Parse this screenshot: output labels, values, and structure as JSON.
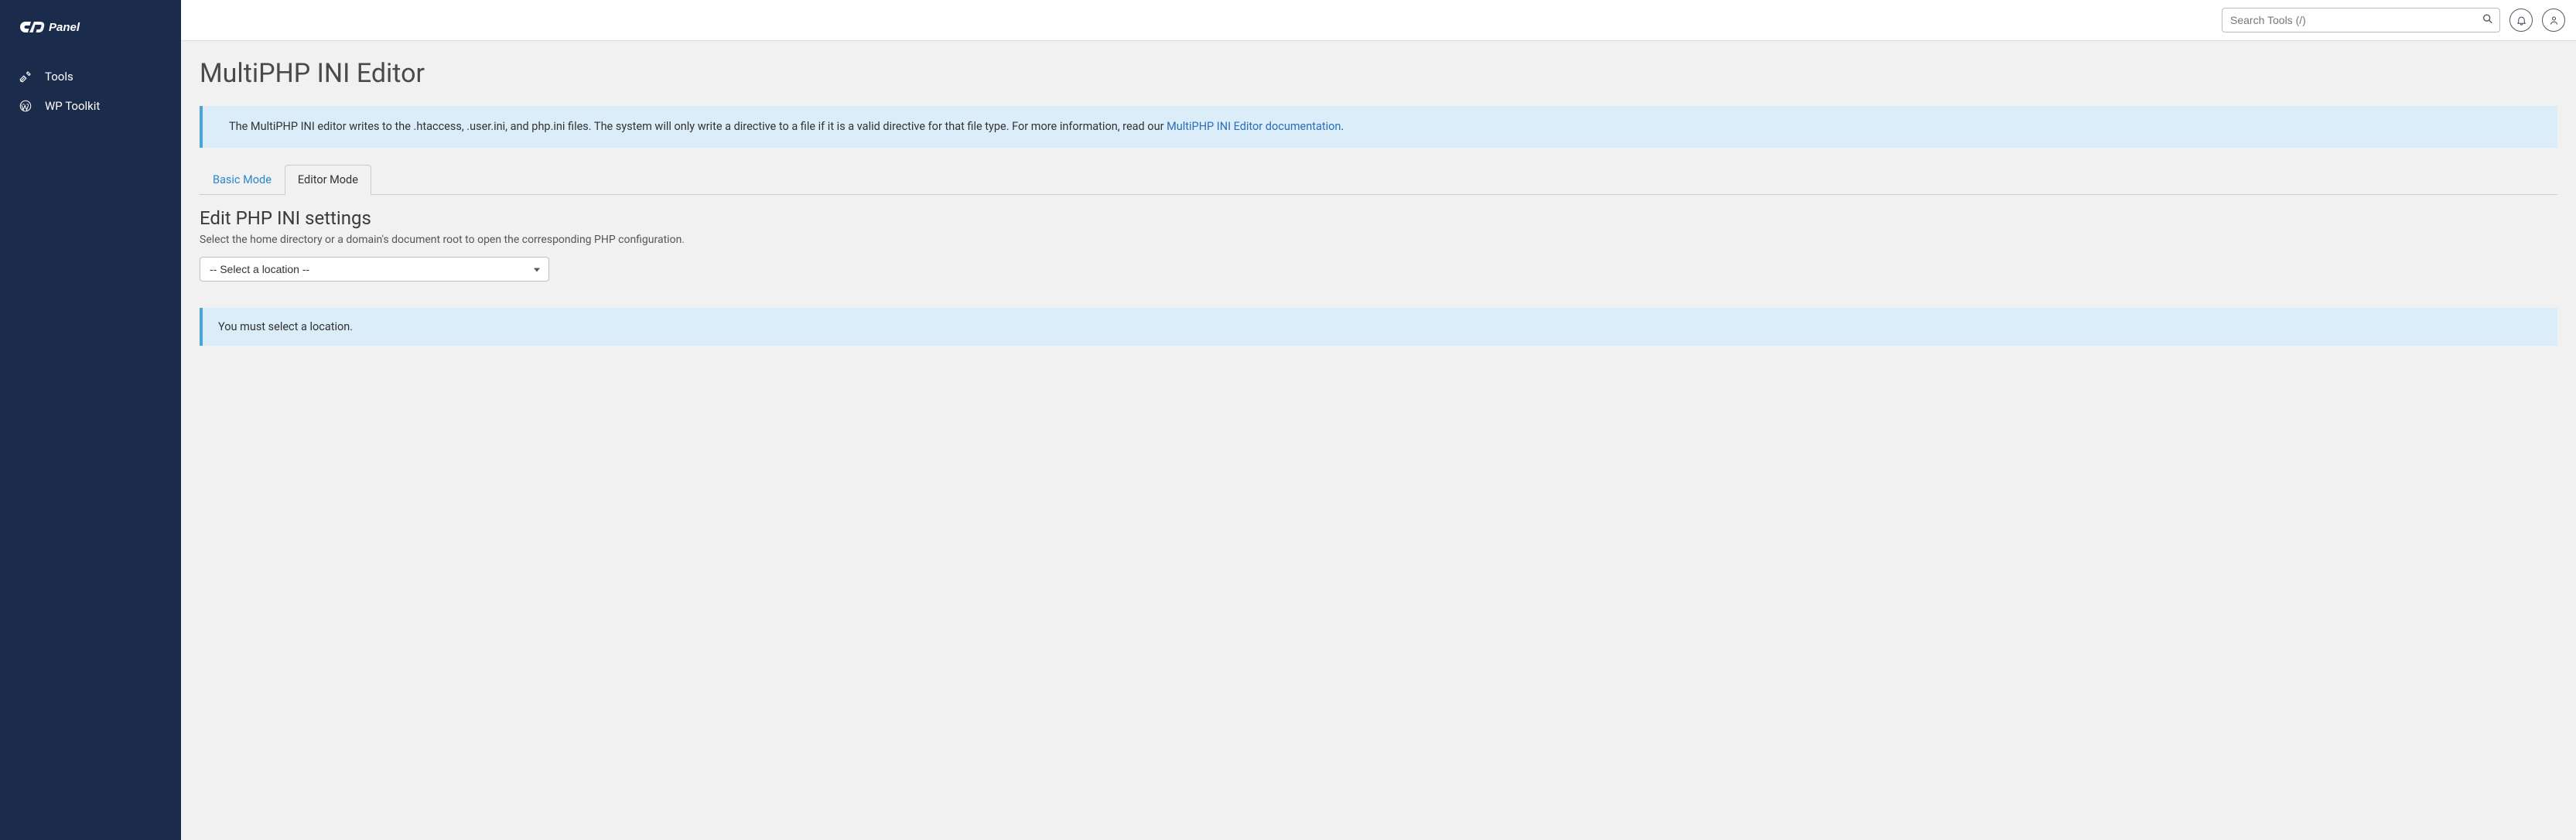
{
  "brand": "cPanel",
  "sidebar": {
    "items": [
      {
        "label": "Tools",
        "icon": "tools-icon"
      },
      {
        "label": "WP Toolkit",
        "icon": "wordpress-icon"
      }
    ]
  },
  "topbar": {
    "search_placeholder": "Search Tools (/)"
  },
  "page": {
    "title": "MultiPHP INI Editor",
    "info_text": "The MultiPHP INI editor writes to the .htaccess, .user.ini, and php.ini files. The system will only write a directive to a file if it is a valid directive for that file type. For more information, read our ",
    "info_link_text": "MultiPHP INI Editor documentation",
    "info_suffix": ".",
    "tabs": [
      {
        "label": "Basic Mode",
        "active": false
      },
      {
        "label": "Editor Mode",
        "active": true
      }
    ],
    "section_title": "Edit PHP INI settings",
    "section_desc": "Select the home directory or a domain's document root to open the corresponding PHP configuration.",
    "location_select": "-- Select a location --",
    "warn_text": "You must select a location."
  }
}
